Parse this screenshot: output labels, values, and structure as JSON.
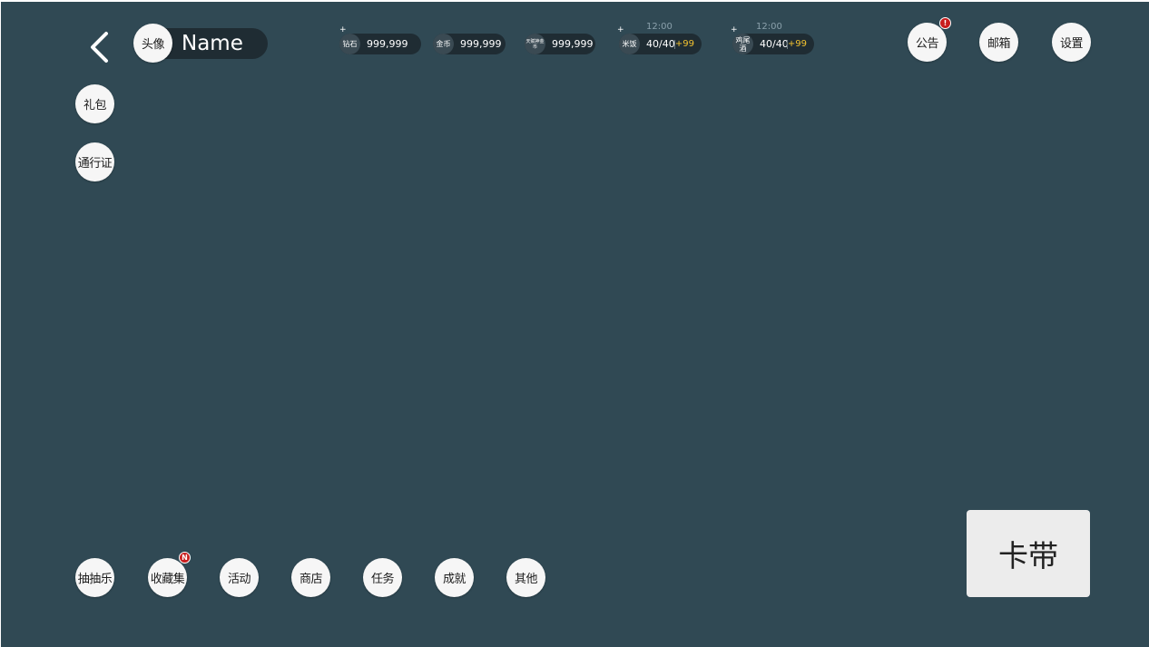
{
  "header": {
    "avatar_label": "头像",
    "player_name": "Name"
  },
  "resources": [
    {
      "id": "diamond",
      "label": "钻石",
      "value": "999,999",
      "plus": "+"
    },
    {
      "id": "gold",
      "label": "金币",
      "value": "999,999"
    },
    {
      "id": "special",
      "label": "天赋神金币",
      "value": "999,999"
    },
    {
      "id": "rice",
      "label": "米饭",
      "value": "40/40",
      "bonus": "+99",
      "timer": "12:00",
      "plus": "+"
    },
    {
      "id": "cocktail",
      "label": "鸡尾酒",
      "value": "40/40",
      "bonus": "+99",
      "timer": "12:00",
      "plus": "+"
    }
  ],
  "top_right": {
    "notice": "公告",
    "notice_badge": "!",
    "mail": "邮箱",
    "settings": "设置"
  },
  "left_menu": {
    "gift": "礼包",
    "pass": "通行证"
  },
  "bottom_menu": {
    "gacha": "抽抽乐",
    "collection": "收藏集",
    "collection_badge": "N",
    "events": "活动",
    "shop": "商店",
    "tasks": "任务",
    "achievements": "成就",
    "other": "其他"
  },
  "card_button": "卡带",
  "colors": {
    "background": "#304954",
    "pill": "#1f2c33",
    "button": "#f6f6f6",
    "badge": "#c81e1e",
    "bonus": "#f2c230"
  }
}
